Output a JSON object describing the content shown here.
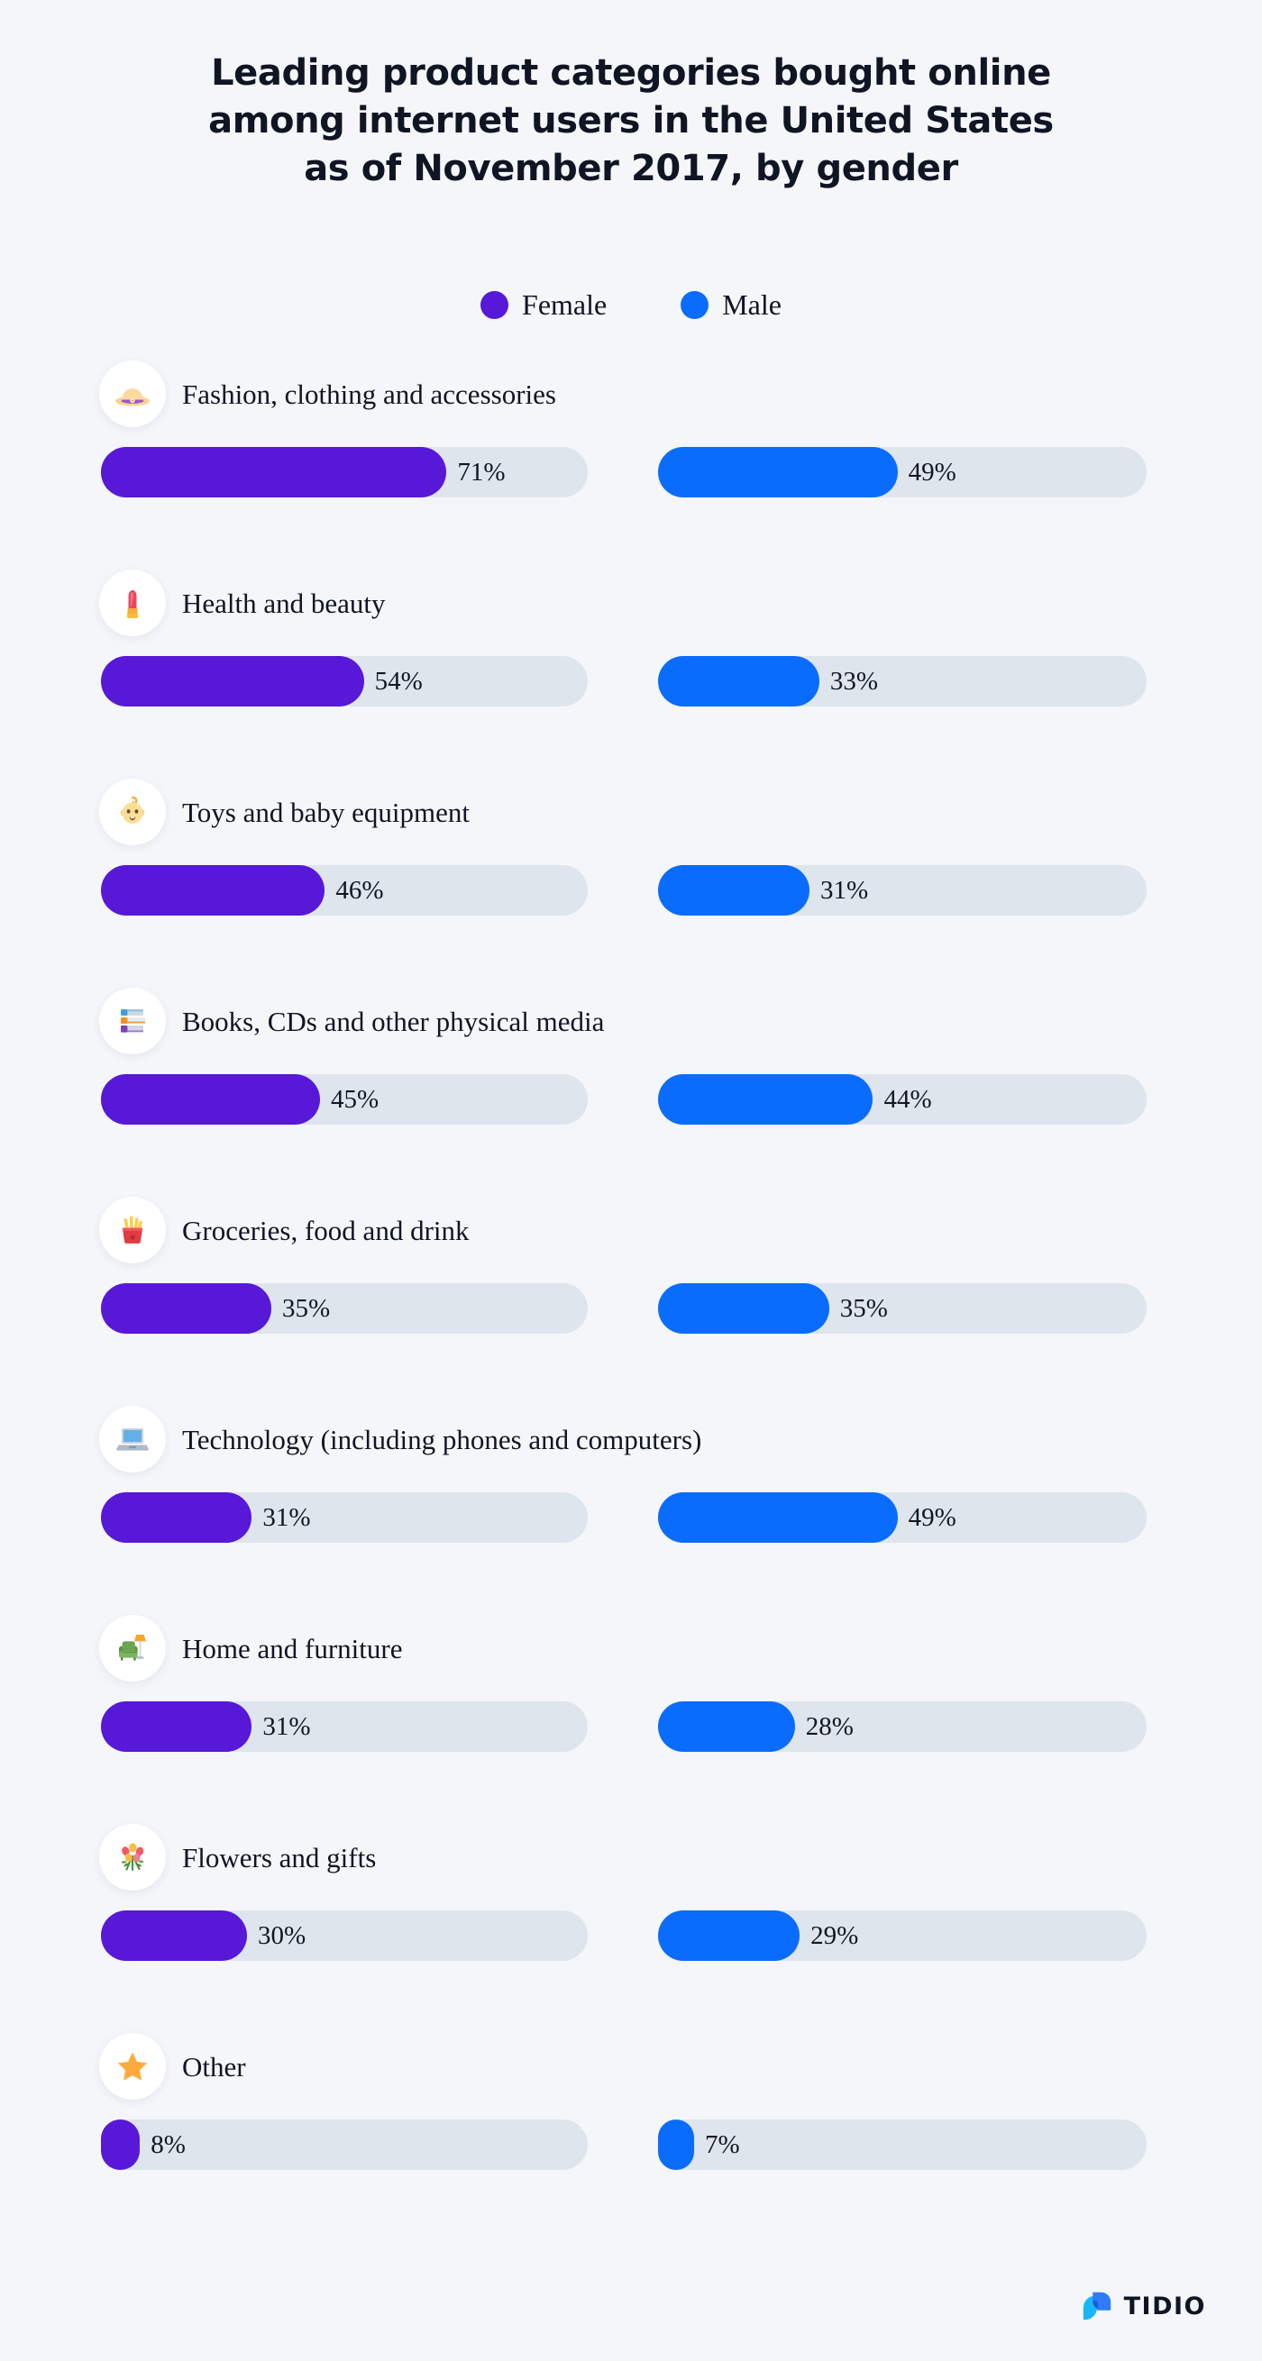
{
  "title": {
    "line1": "Leading product categories bought online",
    "line2": "among internet users in the United States",
    "line3": "as of November 2017, by gender"
  },
  "legend": {
    "items": [
      {
        "label": "Female",
        "color": "#5718d8",
        "icon": "circle-icon"
      },
      {
        "label": "Male",
        "color": "#0a6cfd",
        "icon": "circle-icon"
      }
    ]
  },
  "brand": {
    "name": "TIDIO",
    "mark_color": "#0a6cfd",
    "mark_color_2": "#19b6ff"
  },
  "colors": {
    "background": "#f4f6f9",
    "track": "#dfe5ec",
    "female": "#5718d8",
    "male": "#0a6cfd",
    "text": "#101524",
    "badge": "#ffffff"
  },
  "chart_data": {
    "type": "bar",
    "title": "Leading product categories bought online among internet users in the United States as of November 2017, by gender",
    "xlabel": "",
    "ylabel": "",
    "xlim": [
      0,
      100
    ],
    "grid": false,
    "legend_position": "top-center",
    "orientation": "horizontal",
    "unit": "%",
    "categories": [
      "Fashion, clothing and accessories",
      "Health and beauty",
      "Toys and baby equipment",
      "Books, CDs and other physical media",
      "Groceries, food and drink",
      "Technology (including phones and computers)",
      "Home and furniture",
      "Flowers and gifts",
      "Other"
    ],
    "series": [
      {
        "name": "Female",
        "color": "#5718d8",
        "values": [
          71,
          54,
          46,
          45,
          35,
          31,
          31,
          30,
          8
        ]
      },
      {
        "name": "Male",
        "color": "#0a6cfd",
        "values": [
          49,
          33,
          31,
          44,
          35,
          49,
          28,
          29,
          7
        ]
      }
    ]
  },
  "rows": [
    {
      "icon": "sun-hat-icon",
      "label": "Fashion, clothing and accessories",
      "female": {
        "value": 71,
        "text": "71%"
      },
      "male": {
        "value": 49,
        "text": "49%"
      }
    },
    {
      "icon": "lipstick-icon",
      "label": "Health and beauty",
      "female": {
        "value": 54,
        "text": "54%"
      },
      "male": {
        "value": 33,
        "text": "33%"
      }
    },
    {
      "icon": "baby-icon",
      "label": "Toys and baby equipment",
      "female": {
        "value": 46,
        "text": "46%"
      },
      "male": {
        "value": 31,
        "text": "31%"
      }
    },
    {
      "icon": "books-icon",
      "label": "Books, CDs and other physical media",
      "female": {
        "value": 45,
        "text": "45%"
      },
      "male": {
        "value": 44,
        "text": "44%"
      }
    },
    {
      "icon": "french-fries-icon",
      "label": "Groceries, food and drink",
      "female": {
        "value": 35,
        "text": "35%"
      },
      "male": {
        "value": 35,
        "text": "35%"
      }
    },
    {
      "icon": "laptop-icon",
      "label": "Technology (including phones and computers)",
      "female": {
        "value": 31,
        "text": "31%"
      },
      "male": {
        "value": 49,
        "text": "49%"
      }
    },
    {
      "icon": "couch-lamp-icon",
      "label": "Home and furniture",
      "female": {
        "value": 31,
        "text": "31%"
      },
      "male": {
        "value": 28,
        "text": "28%"
      }
    },
    {
      "icon": "bouquet-icon",
      "label": "Flowers and gifts",
      "female": {
        "value": 30,
        "text": "30%"
      },
      "male": {
        "value": 29,
        "text": "29%"
      }
    },
    {
      "icon": "star-icon",
      "label": "Other",
      "female": {
        "value": 8,
        "text": "8%"
      },
      "male": {
        "value": 7,
        "text": "7%"
      }
    }
  ]
}
